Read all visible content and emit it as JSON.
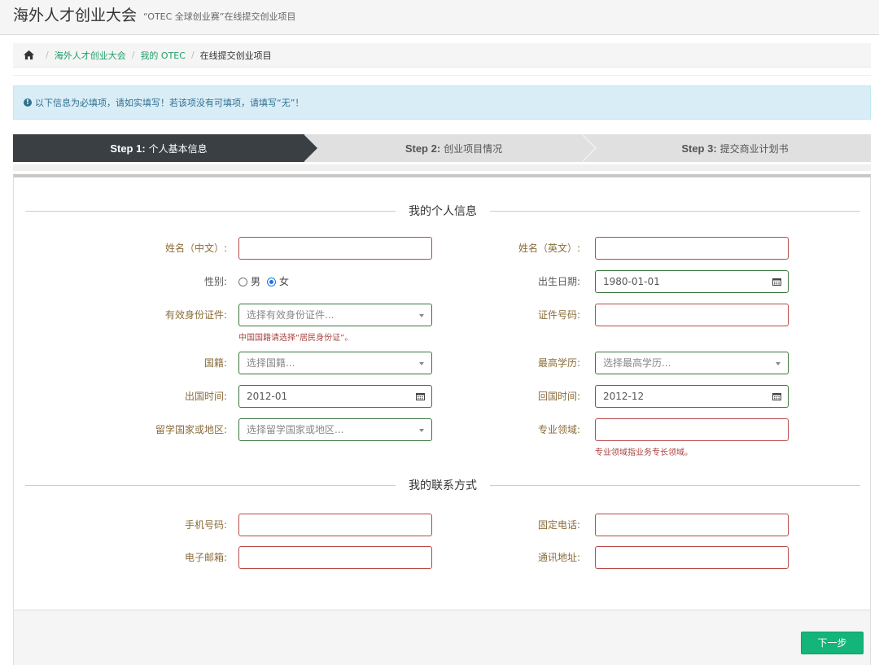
{
  "header": {
    "title": "海外人才创业大会",
    "subtitle": "“OTEC 全球创业赛”在线提交创业项目"
  },
  "breadcrumb": {
    "items": [
      "海外人才创业大会",
      "我的 OTEC"
    ],
    "current": "在线提交创业项目"
  },
  "alert": "以下信息为必填项，请如实填写！若该项没有可填项，请填写“无”！",
  "steps": [
    {
      "num": "Step 1:",
      "label": "个人基本信息",
      "active": true
    },
    {
      "num": "Step 2:",
      "label": "创业项目情况",
      "active": false
    },
    {
      "num": "Step 3:",
      "label": "提交商业计划书",
      "active": false
    }
  ],
  "sections": {
    "personal": "我的个人信息",
    "contact": "我的联系方式"
  },
  "form": {
    "name_cn": {
      "label": "姓名（中文）:",
      "value": ""
    },
    "name_en": {
      "label": "姓名（英文）:",
      "value": ""
    },
    "gender": {
      "label": "性别:",
      "options": [
        "男",
        "女"
      ],
      "selected": "女"
    },
    "birth": {
      "label": "出生日期:",
      "value": "1980-01-01"
    },
    "id_type": {
      "label": "有效身份证件:",
      "placeholder": "选择有效身份证件...",
      "help": "中国国籍请选择“居民身份证”。"
    },
    "id_no": {
      "label": "证件号码:",
      "value": ""
    },
    "nationality": {
      "label": "国籍:",
      "placeholder": "选择国籍..."
    },
    "education": {
      "label": "最高学历:",
      "placeholder": "选择最高学历..."
    },
    "leave_date": {
      "label": "出国时间:",
      "value": "2012-01"
    },
    "return_date": {
      "label": "回国时间:",
      "value": "2012-12"
    },
    "study_country": {
      "label": "留学国家或地区:",
      "placeholder": "选择留学国家或地区..."
    },
    "major": {
      "label": "专业领域:",
      "value": "",
      "help": "专业领域指业务专长领域。"
    },
    "mobile": {
      "label": "手机号码:",
      "value": ""
    },
    "phone": {
      "label": "固定电话:",
      "value": ""
    },
    "email": {
      "label": "电子邮箱:",
      "value": ""
    },
    "address": {
      "label": "通讯地址:",
      "value": ""
    }
  },
  "buttons": {
    "next": "下一步"
  },
  "icons": [
    "home-icon",
    "info-icon",
    "calendar-icon",
    "chevron-down-icon"
  ],
  "colors": {
    "error": "#b94a48",
    "success": "#3c763d",
    "primary": "#13b57a",
    "step_active": "#3a3f44",
    "alert_bg": "#d9edf7"
  }
}
